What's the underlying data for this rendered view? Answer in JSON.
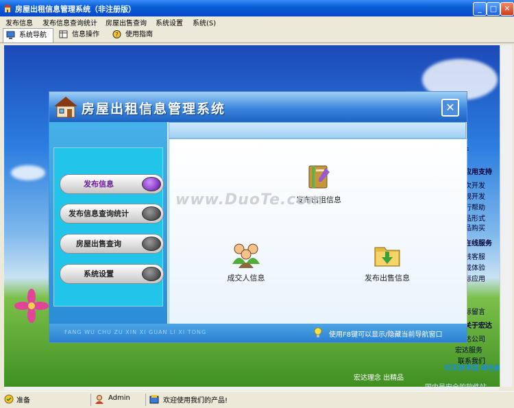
{
  "window": {
    "title": "房屋出租信息管理系统（非注册版）"
  },
  "menu": [
    "发布信息",
    "发布信息查询统计",
    "房屋出售查询",
    "系统设置",
    "系统(S)"
  ],
  "tabs": [
    "系统导航",
    "信息操作",
    "使用指南"
  ],
  "background": {
    "side_items": [
      "件",
      "应用支持",
      "次开发",
      "规开发",
      "行帮助",
      "品形式",
      "品购买",
      "在线服务",
      "线客服",
      "载体验",
      "标应用",
      "标留言",
      "关于宏达",
      "达公司",
      "宏达服务",
      "联系我们"
    ],
    "bottom_text": "宏达理念   出精品",
    "brand_watermark": "华军软件园 绿色软件大全",
    "brand_sub": "国内最安全的软件站"
  },
  "dialog": {
    "title": "房屋出租信息管理系统",
    "nav": [
      "发布信息",
      "发布信息查询统计",
      "房屋出售查询",
      "系统设置"
    ],
    "features": {
      "rent": "发布出租信息",
      "deal": "成交人信息",
      "sale": "发布出售信息"
    },
    "watermark": "www.DuoTe.com",
    "footer_pinyin": "FANG WU CHU ZU XIN XI GUAN LI XI TONG",
    "tip": "使用F8键可以显示/隐藏当前导航窗口"
  },
  "status": {
    "ready": "准备",
    "user": "Admin",
    "welcome": "欢迎使用我们的产品!"
  },
  "colors": {
    "accent": "#2b8dd7",
    "knob_active": "#5a0ea0",
    "title_blue": "#0a5fd8"
  }
}
